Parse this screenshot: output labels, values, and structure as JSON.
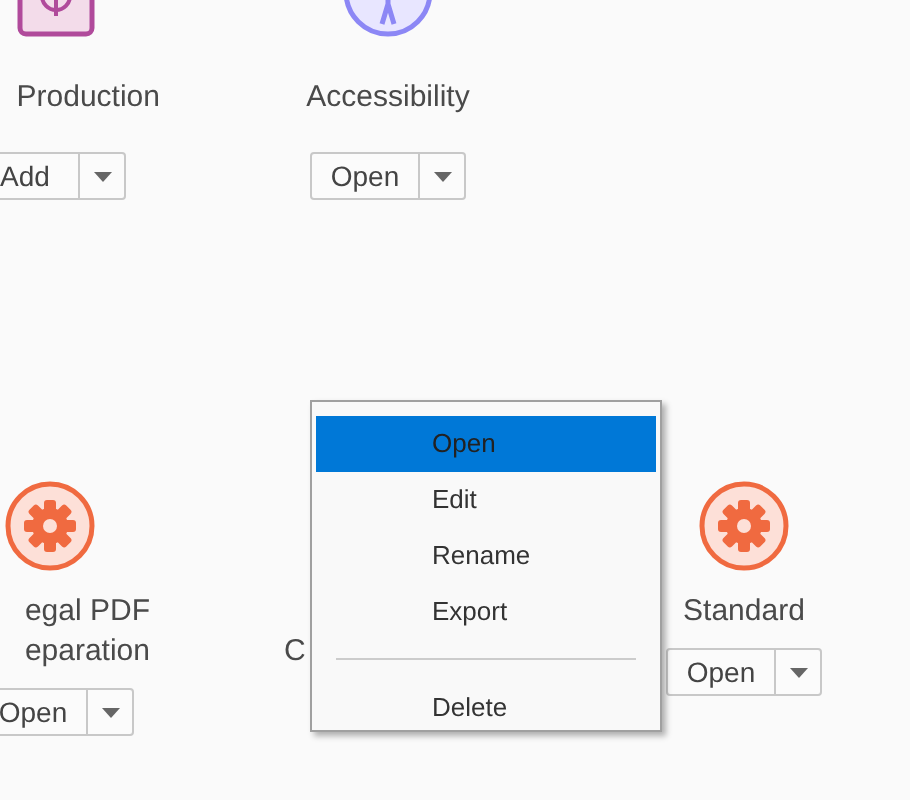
{
  "rows": [
    [
      {
        "kind": "crosshair",
        "label_lines": [
          "Production"
        ],
        "button": "Add"
      },
      {
        "kind": "figure",
        "label_lines": [
          "Accessibility"
        ],
        "button": "Open"
      }
    ],
    [
      {
        "kind": "gear",
        "label_lines": [
          "egal PDF",
          "eparation"
        ],
        "button": "Open"
      },
      {
        "kind": "none",
        "label_lines": [
          "C"
        ]
      },
      {
        "kind": "gear",
        "label_lines": [
          "Standard"
        ],
        "button": "Open"
      }
    ]
  ],
  "context_menu": {
    "items": [
      {
        "kind": "item",
        "label": "Open",
        "selected": true
      },
      {
        "kind": "item",
        "label": "Edit",
        "selected": false
      },
      {
        "kind": "item",
        "label": "Rename",
        "selected": false
      },
      {
        "kind": "item",
        "label": "Export",
        "selected": false
      },
      {
        "kind": "separator"
      },
      {
        "kind": "item",
        "label": "Delete",
        "selected": false
      }
    ]
  }
}
